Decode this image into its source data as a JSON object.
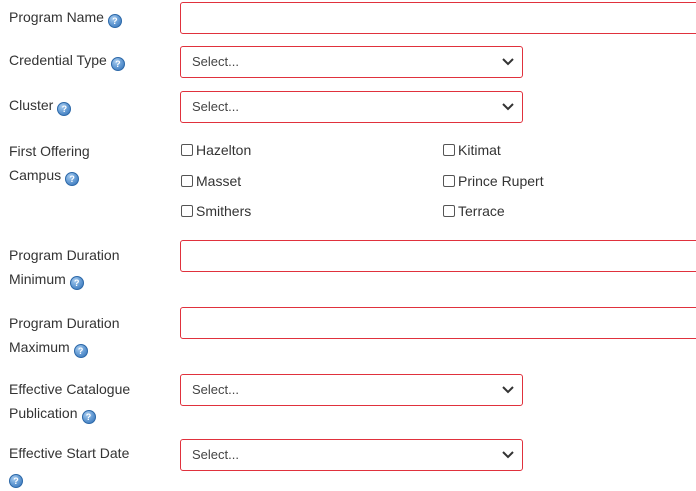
{
  "fields": {
    "program_name": {
      "label": "Program Name",
      "value": ""
    },
    "credential_type": {
      "label": "Credential Type",
      "selected": "Select..."
    },
    "cluster": {
      "label": "Cluster",
      "selected": "Select..."
    },
    "first_offering_campus": {
      "label_line1": "First Offering",
      "label_line2": "Campus",
      "options": [
        {
          "label": "Hazelton",
          "checked": false
        },
        {
          "label": "Kitimat",
          "checked": false
        },
        {
          "label": "Masset",
          "checked": false
        },
        {
          "label": "Prince Rupert",
          "checked": false
        },
        {
          "label": "Smithers",
          "checked": false
        },
        {
          "label": "Terrace",
          "checked": false
        }
      ]
    },
    "program_duration_minimum": {
      "label_line1": "Program Duration",
      "label_line2": "Minimum",
      "value": ""
    },
    "program_duration_maximum": {
      "label_line1": "Program Duration",
      "label_line2": "Maximum",
      "value": ""
    },
    "effective_catalogue_publication": {
      "label_line1": "Effective Catalogue",
      "label_line2": "Publication",
      "selected": "Select..."
    },
    "effective_start_date": {
      "label": "Effective Start Date",
      "selected": "Select..."
    }
  },
  "help_icon": "question-help-icon",
  "colors": {
    "invalid_border": "#e0313d",
    "help_icon": "#2f6fb6"
  }
}
